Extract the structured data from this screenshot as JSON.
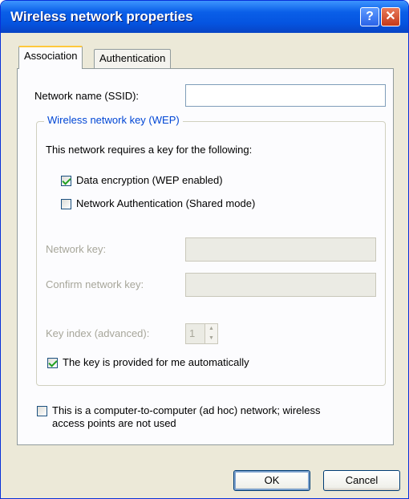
{
  "window": {
    "title": "Wireless network properties",
    "help_label": "?",
    "close_label": "✕"
  },
  "tabs": [
    {
      "label": "Association"
    },
    {
      "label": "Authentication"
    }
  ],
  "ssid": {
    "label": "Network name (SSID):",
    "value": ""
  },
  "wep_group": {
    "title": "Wireless network key (WEP)",
    "requires_text": "This network requires a key for the following:",
    "data_encryption": {
      "label": "Data encryption (WEP enabled)",
      "checked": true
    },
    "network_auth": {
      "label": "Network Authentication (Shared mode)",
      "checked": false
    },
    "network_key": {
      "label": "Network key:",
      "value": ""
    },
    "confirm_key": {
      "label": "Confirm network key:",
      "value": ""
    },
    "key_index": {
      "label": "Key index (advanced):",
      "value": "1"
    },
    "auto_key": {
      "label": "The key is provided for me automatically",
      "checked": true
    }
  },
  "adhoc": {
    "label_line1": "This is a computer-to-computer (ad hoc) network; wireless",
    "label_line2": "access points are not used",
    "checked": false
  },
  "buttons": {
    "ok": "OK",
    "cancel": "Cancel"
  }
}
